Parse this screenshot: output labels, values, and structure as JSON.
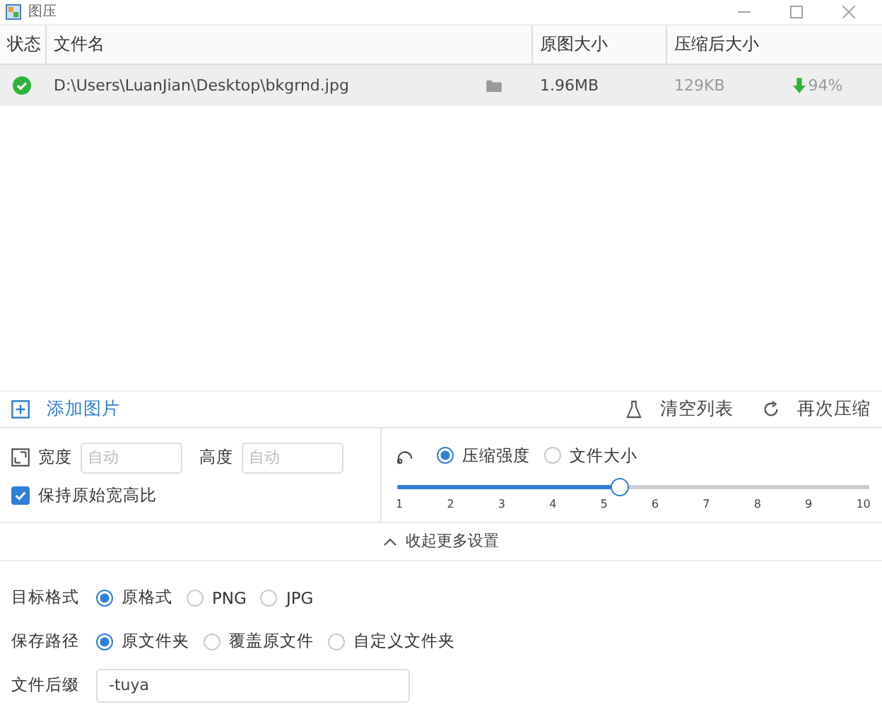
{
  "window": {
    "title": "图压"
  },
  "table": {
    "columns": [
      "状态",
      "文件名",
      "原图大小",
      "压缩后大小"
    ],
    "rows": [
      {
        "selected": true,
        "done": true,
        "file": "D:\\Users\\LuanJian\\Desktop\\bkgrnd.jpg",
        "original": "1.96MB",
        "compressed": "129KB",
        "saving": "94%"
      }
    ]
  },
  "toolbar": {
    "add": "添加图片",
    "clear": "清空列表",
    "recompress": "再次压缩"
  },
  "resize": {
    "width_label": "宽度",
    "width_placeholder": "自动",
    "height_label": "高度",
    "height_placeholder": "自动",
    "keep_ratio": {
      "label": "保持原始宽高比",
      "checked": true
    }
  },
  "compression": {
    "modes": [
      {
        "label": "压缩强度",
        "selected": true
      },
      {
        "label": "文件大小",
        "selected": false
      }
    ],
    "level": 0.47,
    "ticks": [
      "1",
      "2",
      "3",
      "4",
      "5",
      "6",
      "7",
      "8",
      "9",
      "10"
    ]
  },
  "collapse": {
    "label": "收起更多设置",
    "expanded": true
  },
  "settings": [
    {
      "label": "目标格式",
      "kind": "radio",
      "options": [
        {
          "label": "原格式",
          "selected": true
        },
        {
          "label": "PNG",
          "selected": false
        },
        {
          "label": "JPG",
          "selected": false
        }
      ]
    },
    {
      "label": "保存路径",
      "kind": "radio",
      "options": [
        {
          "label": "原文件夹",
          "selected": true
        },
        {
          "label": "覆盖原文件",
          "selected": false
        },
        {
          "label": "自定义文件夹",
          "selected": false
        }
      ]
    },
    {
      "label": "文件后缀",
      "kind": "input",
      "value": "-tuya"
    }
  ]
}
